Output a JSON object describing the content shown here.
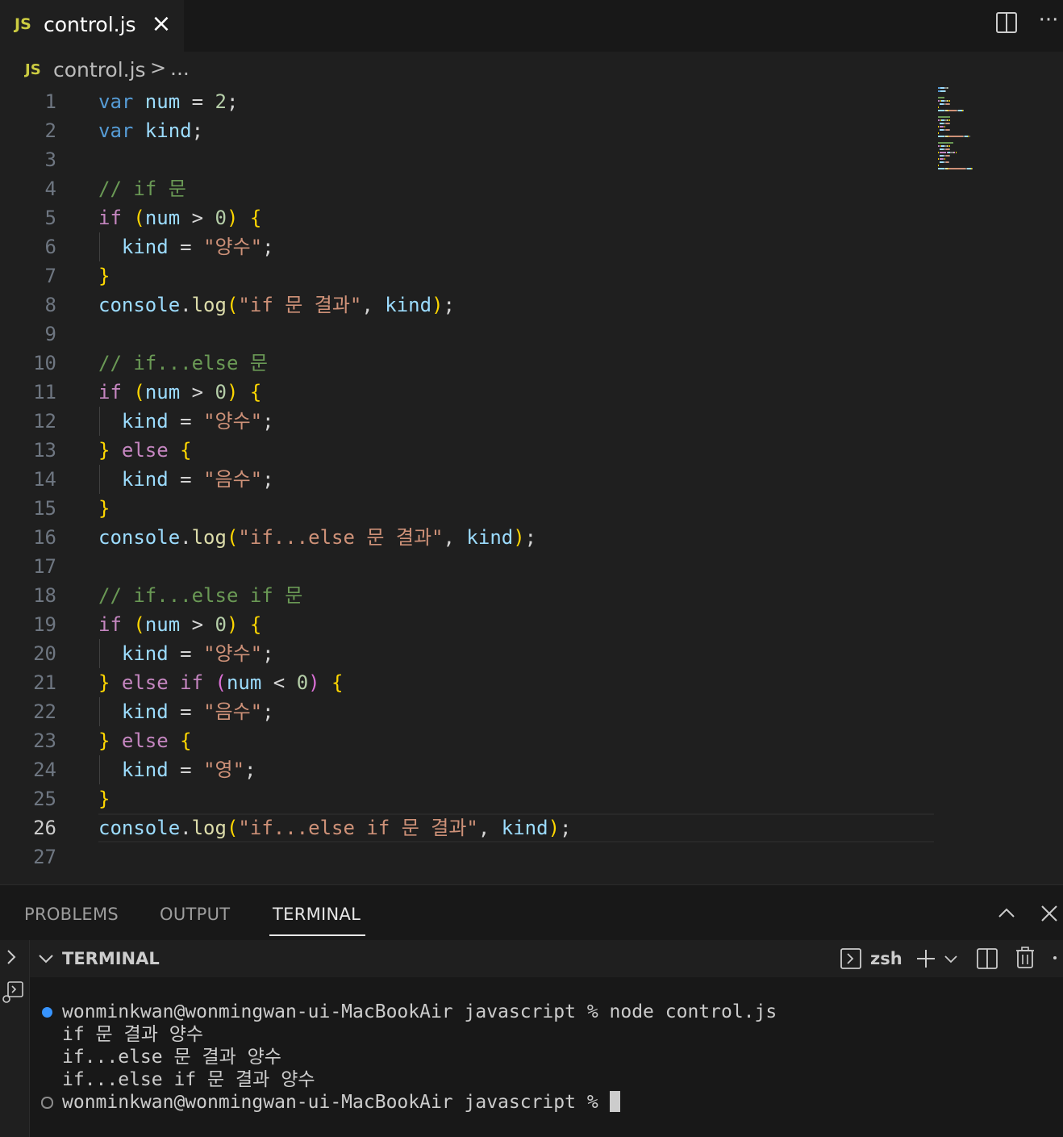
{
  "tab": {
    "icon_text": "JS",
    "filename": "control.js"
  },
  "breadcrumb": {
    "icon_text": "JS",
    "file": "control.js",
    "separator": ">",
    "symbol": "..."
  },
  "editor": {
    "active_line": 26,
    "lines": [
      [
        [
          "kw",
          "var"
        ],
        [
          "var",
          " num"
        ],
        [
          "pl",
          " = "
        ],
        [
          "num",
          "2"
        ],
        [
          "pl",
          ";"
        ]
      ],
      [
        [
          "kw",
          "var"
        ],
        [
          "var",
          " kind"
        ],
        [
          "pl",
          ";"
        ]
      ],
      [],
      [
        [
          "cmt",
          "// if 문"
        ]
      ],
      [
        [
          "ctl",
          "if"
        ],
        [
          "pl",
          " "
        ],
        [
          "br1",
          "("
        ],
        [
          "var",
          "num"
        ],
        [
          "pl",
          " > "
        ],
        [
          "num",
          "0"
        ],
        [
          "br1",
          ")"
        ],
        [
          "pl",
          " "
        ],
        [
          "br1",
          "{"
        ]
      ],
      [
        [
          "pl",
          "  "
        ],
        [
          "var",
          "kind"
        ],
        [
          "pl",
          " = "
        ],
        [
          "str",
          "\"양수\""
        ],
        [
          "pl",
          ";"
        ]
      ],
      [
        [
          "br1",
          "}"
        ]
      ],
      [
        [
          "var",
          "console"
        ],
        [
          "pl",
          "."
        ],
        [
          "fn",
          "log"
        ],
        [
          "br1",
          "("
        ],
        [
          "str",
          "\"if 문 결과\""
        ],
        [
          "pl",
          ", "
        ],
        [
          "var",
          "kind"
        ],
        [
          "br1",
          ")"
        ],
        [
          "pl",
          ";"
        ]
      ],
      [],
      [
        [
          "cmt",
          "// if...else 문"
        ]
      ],
      [
        [
          "ctl",
          "if"
        ],
        [
          "pl",
          " "
        ],
        [
          "br1",
          "("
        ],
        [
          "var",
          "num"
        ],
        [
          "pl",
          " > "
        ],
        [
          "num",
          "0"
        ],
        [
          "br1",
          ")"
        ],
        [
          "pl",
          " "
        ],
        [
          "br1",
          "{"
        ]
      ],
      [
        [
          "pl",
          "  "
        ],
        [
          "var",
          "kind"
        ],
        [
          "pl",
          " = "
        ],
        [
          "str",
          "\"양수\""
        ],
        [
          "pl",
          ";"
        ]
      ],
      [
        [
          "br1",
          "}"
        ],
        [
          "pl",
          " "
        ],
        [
          "ctl",
          "else"
        ],
        [
          "pl",
          " "
        ],
        [
          "br1",
          "{"
        ]
      ],
      [
        [
          "pl",
          "  "
        ],
        [
          "var",
          "kind"
        ],
        [
          "pl",
          " = "
        ],
        [
          "str",
          "\"음수\""
        ],
        [
          "pl",
          ";"
        ]
      ],
      [
        [
          "br1",
          "}"
        ]
      ],
      [
        [
          "var",
          "console"
        ],
        [
          "pl",
          "."
        ],
        [
          "fn",
          "log"
        ],
        [
          "br1",
          "("
        ],
        [
          "str",
          "\"if...else 문 결과\""
        ],
        [
          "pl",
          ", "
        ],
        [
          "var",
          "kind"
        ],
        [
          "br1",
          ")"
        ],
        [
          "pl",
          ";"
        ]
      ],
      [],
      [
        [
          "cmt",
          "// if...else if 문"
        ]
      ],
      [
        [
          "ctl",
          "if"
        ],
        [
          "pl",
          " "
        ],
        [
          "br1",
          "("
        ],
        [
          "var",
          "num"
        ],
        [
          "pl",
          " > "
        ],
        [
          "num",
          "0"
        ],
        [
          "br1",
          ")"
        ],
        [
          "pl",
          " "
        ],
        [
          "br1",
          "{"
        ]
      ],
      [
        [
          "pl",
          "  "
        ],
        [
          "var",
          "kind"
        ],
        [
          "pl",
          " = "
        ],
        [
          "str",
          "\"양수\""
        ],
        [
          "pl",
          ";"
        ]
      ],
      [
        [
          "br1",
          "}"
        ],
        [
          "pl",
          " "
        ],
        [
          "ctl",
          "else if"
        ],
        [
          "pl",
          " "
        ],
        [
          "br2",
          "("
        ],
        [
          "var",
          "num"
        ],
        [
          "pl",
          " < "
        ],
        [
          "num",
          "0"
        ],
        [
          "br2",
          ")"
        ],
        [
          "pl",
          " "
        ],
        [
          "br1",
          "{"
        ]
      ],
      [
        [
          "pl",
          "  "
        ],
        [
          "var",
          "kind"
        ],
        [
          "pl",
          " = "
        ],
        [
          "str",
          "\"음수\""
        ],
        [
          "pl",
          ";"
        ]
      ],
      [
        [
          "br1",
          "}"
        ],
        [
          "pl",
          " "
        ],
        [
          "ctl",
          "else"
        ],
        [
          "pl",
          " "
        ],
        [
          "br1",
          "{"
        ]
      ],
      [
        [
          "pl",
          "  "
        ],
        [
          "var",
          "kind"
        ],
        [
          "pl",
          " = "
        ],
        [
          "str",
          "\"영\""
        ],
        [
          "pl",
          ";"
        ]
      ],
      [
        [
          "br1",
          "}"
        ]
      ],
      [
        [
          "var",
          "console"
        ],
        [
          "pl",
          "."
        ],
        [
          "fn",
          "log"
        ],
        [
          "br1",
          "("
        ],
        [
          "str",
          "\"if...else if 문 결과\""
        ],
        [
          "pl",
          ", "
        ],
        [
          "var",
          "kind"
        ],
        [
          "br1",
          ")"
        ],
        [
          "pl",
          ";"
        ]
      ],
      []
    ]
  },
  "panel": {
    "tabs": [
      "PROBLEMS",
      "OUTPUT",
      "TERMINAL"
    ],
    "active_tab": "TERMINAL",
    "terminal_header": "TERMINAL",
    "shell": "zsh",
    "lines": [
      "wonminkwan@wonmingwan-ui-MacBookAir javascript % node control.js",
      "if 문 결과 양수",
      "if...else 문 결과 양수",
      "if...else if 문 결과 양수",
      "wonminkwan@wonmingwan-ui-MacBookAir javascript % "
    ]
  },
  "colors": {
    "accent_dot": "#3794ff",
    "keyword": "#569cd6",
    "control": "#c586c0",
    "variable": "#9cdcfe",
    "string": "#ce9178",
    "comment": "#6a9955",
    "function": "#dcdcaa",
    "number": "#b5cea8",
    "bracket": "#ffd700"
  }
}
